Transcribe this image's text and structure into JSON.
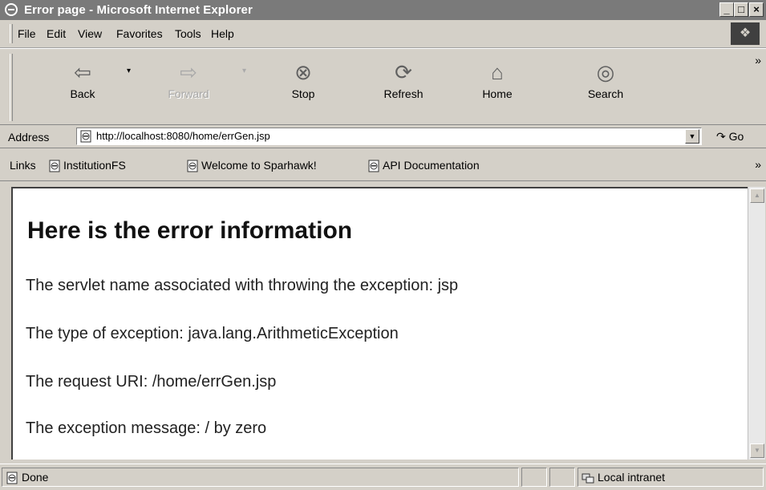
{
  "window": {
    "title": "Error page - Microsoft Internet Explorer",
    "minimize_glyph": "_",
    "maximize_glyph": "□",
    "close_glyph": "×"
  },
  "menu": {
    "items": [
      "File",
      "Edit",
      "View",
      "Favorites",
      "Tools",
      "Help"
    ]
  },
  "toolbar": {
    "back": "Back",
    "forward": "Forward",
    "stop": "Stop",
    "refresh": "Refresh",
    "home": "Home",
    "search": "Search",
    "more": "»"
  },
  "address": {
    "label": "Address",
    "url": "http://localhost:8080/home/errGen.jsp",
    "go": "Go"
  },
  "links": {
    "label": "Links",
    "items": [
      "InstitutionFS",
      "Welcome to Sparhawk!",
      "API Documentation"
    ],
    "more": "»"
  },
  "page": {
    "heading": "Here is the error information",
    "lines": [
      "The servlet name associated with throwing the exception: jsp",
      "The type of exception: java.lang.ArithmeticException",
      "The request URI: /home/errGen.jsp",
      "The exception message: / by zero"
    ]
  },
  "status": {
    "text": "Done",
    "zone": "Local intranet"
  },
  "icons": {
    "ie": "ie-logo-icon",
    "back": "back-arrow-icon",
    "forward": "forward-arrow-icon",
    "stop": "stop-icon",
    "refresh": "refresh-icon",
    "home": "home-icon",
    "search": "search-icon",
    "page": "page-icon",
    "zone": "intranet-icon"
  }
}
